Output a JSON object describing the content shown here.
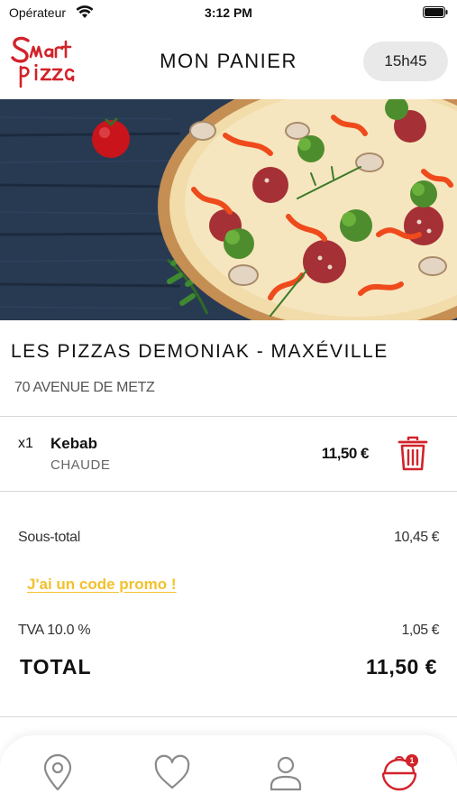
{
  "status_bar": {
    "carrier": "Opérateur",
    "time": "3:12 PM"
  },
  "header": {
    "logo_alt": "Smart pizza",
    "title": "MON PANIER",
    "pickup_time": "15h45"
  },
  "restaurant": {
    "name": "LES PIZZAS DEMONIAK - MAXÉVILLE",
    "address": "70 AVENUE DE METZ"
  },
  "cart": {
    "items": [
      {
        "quantity": "x1",
        "name": "Kebab",
        "option": "CHAUDE",
        "price": "11,50 €"
      }
    ]
  },
  "summary": {
    "subtotal_label": "Sous-total",
    "subtotal_value": "10,45 €",
    "promo_link": "J'ai un code promo !",
    "tax_label": "TVA 10.0 %",
    "tax_value": "1,05 €",
    "total_label": "TOTAL",
    "total_value": "11,50 €"
  },
  "tabbar": {
    "items": [
      {
        "icon": "location-pin-icon"
      },
      {
        "icon": "heart-icon"
      },
      {
        "icon": "user-icon"
      },
      {
        "icon": "basket-icon",
        "badge": "1",
        "active": true
      }
    ]
  },
  "colors": {
    "brand_red": "#d2232a",
    "promo_yellow": "#f2c12e",
    "icon_gray": "#8a8a8a",
    "pill_bg": "#e9e9e9"
  }
}
